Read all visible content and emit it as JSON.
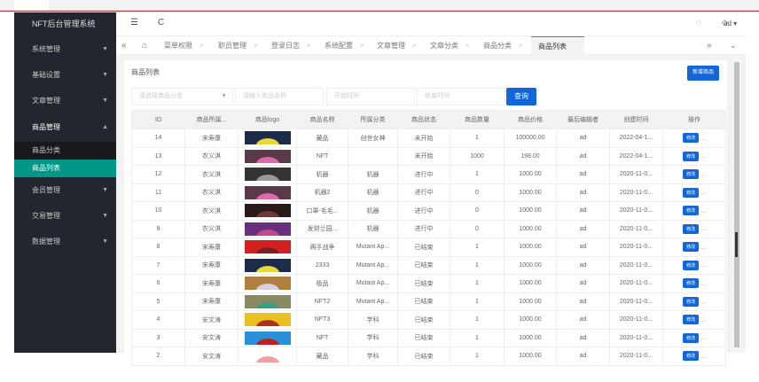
{
  "app_title": "NFT后台管理系统",
  "sidebar": {
    "items": [
      {
        "label": "系统管理"
      },
      {
        "label": "基础设置"
      },
      {
        "label": "文章管理"
      },
      {
        "label": "商品管理"
      },
      {
        "label": "会员管理"
      },
      {
        "label": "交易管理"
      },
      {
        "label": "数据管理"
      }
    ],
    "sub": [
      {
        "label": "商品分类"
      },
      {
        "label": "商品列表"
      }
    ]
  },
  "header": {
    "menu_icon": "☰",
    "refresh_icon": "C",
    "user": "ad"
  },
  "tabs": [
    "菜单权限",
    "职员管理",
    "登录日志",
    "系统配置",
    "文章管理",
    "文章分类",
    "商品分类",
    "商品列表"
  ],
  "page": {
    "title": "商品列表",
    "add_label": "新增商品",
    "category_placeholder": "请选择商品分类",
    "name_placeholder": "请输入商品名称",
    "start_placeholder": "开始时间",
    "end_placeholder": "结束时间",
    "query_label": "查询"
  },
  "table": {
    "columns": [
      "ID",
      "商品所属...",
      "商品logo",
      "商品名称",
      "所属分类",
      "商品状态",
      "商品数量",
      "商品价格",
      "最后编辑者",
      "创建时间",
      "操作"
    ],
    "edit_label": "修改",
    "more": "...",
    "rows": [
      {
        "id": "14",
        "owner": "宋寿康",
        "name": "藏品",
        "cat": "创世女神",
        "status": "未开始",
        "qty": "1",
        "price": "100000.00",
        "editor": "ad",
        "created": "2022-04-1...",
        "c1": "#1c2b4a",
        "c2": "#e8d83a"
      },
      {
        "id": "13",
        "owner": "农义淇",
        "name": "NFT",
        "cat": "",
        "status": "未开始",
        "qty": "1000",
        "price": "198.00",
        "editor": "ad",
        "created": "2022-04-1...",
        "c1": "#5a3a4a",
        "c2": "#e06aa8"
      },
      {
        "id": "12",
        "owner": "农义淇",
        "name": "机器",
        "cat": "机器",
        "status": "进行中",
        "qty": "1",
        "price": "1000.00",
        "editor": "ad",
        "created": "2020-11-0...",
        "c1": "#333",
        "c2": "#999"
      },
      {
        "id": "11",
        "owner": "农义淇",
        "name": "机器2",
        "cat": "机器",
        "status": "进行中",
        "qty": "0",
        "price": "1000.00",
        "editor": "ad",
        "created": "2020-11-0...",
        "c1": "#5a3a4a",
        "c2": "#e06aa8"
      },
      {
        "id": "10",
        "owner": "农义淇",
        "name": "口罩-毛毛...",
        "cat": "机器",
        "status": "进行中",
        "qty": "0",
        "price": "1000.00",
        "editor": "ad",
        "created": "2020-11-0...",
        "c1": "#2a1a1a",
        "c2": "#6a3a3a"
      },
      {
        "id": "9",
        "owner": "农义淇",
        "name": "发财兰园...",
        "cat": "机器",
        "status": "进行中",
        "qty": "0",
        "price": "1000.00",
        "editor": "ad",
        "created": "2020-11-0...",
        "c1": "#6a3080",
        "c2": "#c04a8a"
      },
      {
        "id": "8",
        "owner": "宋寿康",
        "name": "两手战争",
        "cat": "Mutant Ap...",
        "status": "已结束",
        "qty": "1",
        "price": "1000.00",
        "editor": "ad",
        "created": "2020-11-0...",
        "c1": "#d42020",
        "c2": "#7a2020"
      },
      {
        "id": "7",
        "owner": "宋寿康",
        "name": "2333",
        "cat": "Mutant Ap...",
        "status": "已结束",
        "qty": "1",
        "price": "1000.00",
        "editor": "ad",
        "created": "2020-11-0...",
        "c1": "#1c2b4a",
        "c2": "#e8d83a"
      },
      {
        "id": "6",
        "owner": "宋寿康",
        "name": "极品",
        "cat": "Mutant Ap...",
        "status": "已结束",
        "qty": "1",
        "price": "1000.00",
        "editor": "ad",
        "created": "2020-11-0...",
        "c1": "#b08040",
        "c2": "#d8d0e0"
      },
      {
        "id": "5",
        "owner": "宋寿康",
        "name": "NFT2",
        "cat": "Mutant Ap...",
        "status": "已结束",
        "qty": "1",
        "price": "1000.00",
        "editor": "ad",
        "created": "2020-11-0...",
        "c1": "#8a8a60",
        "c2": "#3aa080"
      },
      {
        "id": "4",
        "owner": "安文涛",
        "name": "NFT3",
        "cat": "学科",
        "status": "已结束",
        "qty": "1",
        "price": "1000.00",
        "editor": "ad",
        "created": "2020-11-0...",
        "c1": "#e8c020",
        "c2": "#b03020"
      },
      {
        "id": "3",
        "owner": "安文涛",
        "name": "NFT",
        "cat": "学科",
        "status": "已结束",
        "qty": "1",
        "price": "1000.00",
        "editor": "ad",
        "created": "2020-11-0...",
        "c1": "#2a90d8",
        "c2": "#c02020"
      },
      {
        "id": "2",
        "owner": "安文涛",
        "name": "藏品",
        "cat": "学科",
        "status": "已结束",
        "qty": "1",
        "price": "1000.00",
        "editor": "ad",
        "created": "2020-11-0...",
        "c1": "#fff",
        "c2": "#f0a0a0"
      }
    ]
  }
}
